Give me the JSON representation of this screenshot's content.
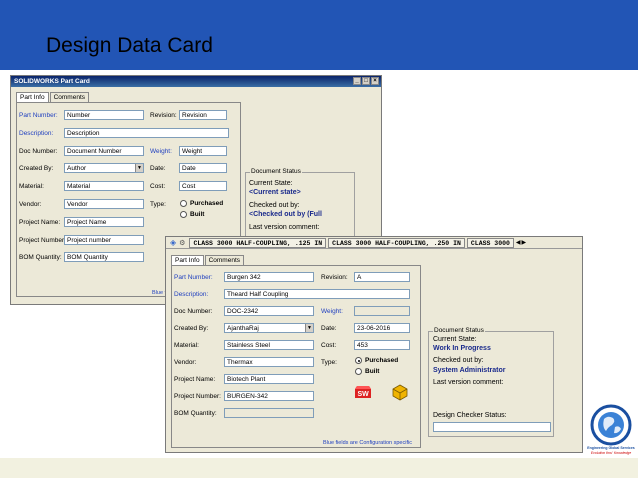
{
  "slide": {
    "title": "Design Data Card"
  },
  "back_window": {
    "title": "SOLIDWORKS Part Card",
    "tabs": [
      "Part Info",
      "Comments"
    ],
    "labels": {
      "part_number": "Part Number:",
      "description": "Description:",
      "doc_number": "Doc Number:",
      "created_by": "Created By:",
      "material": "Material:",
      "vendor": "Vendor:",
      "project_name": "Project Name:",
      "project_number": "Project Number:",
      "bom_quantity": "BOM Quantity:",
      "revision": "Revision:",
      "weight": "Weight:",
      "date": "Date:",
      "cost": "Cost:",
      "type": "Type:"
    },
    "values": {
      "part_number": "Number",
      "description": "Description",
      "doc_number": "Document Number",
      "created_by": "Author",
      "material": "Material",
      "vendor": "Vendor",
      "project_name": "Project Name",
      "project_number": "Project number",
      "bom_quantity": "BOM Quantity",
      "revision": "Revision",
      "weight": "Weight",
      "date": "Date",
      "cost": "Cost"
    },
    "type_options": [
      "Purchased",
      "Built"
    ],
    "status": {
      "group_title": "Document Status",
      "current_state_label": "Current State:",
      "current_state": "<Current state>",
      "checked_out_label": "Checked out by:",
      "checked_out": "<Checked out by (Full",
      "last_version_label": "Last version comment:"
    },
    "footnote": "Blue fie"
  },
  "front_window": {
    "config_tabs": [
      "CLASS 3000 HALF-COUPLING, .125 IN",
      "CLASS 3000 HALF-COUPLING, .250 IN",
      "CLASS 3000"
    ],
    "tabs": [
      "Part Info",
      "Comments"
    ],
    "labels": {
      "part_number": "Part Number:",
      "description": "Description:",
      "doc_number": "Doc Number:",
      "created_by": "Created By:",
      "material": "Material:",
      "vendor": "Vendor:",
      "project_name": "Project Name:",
      "project_number": "Project Number:",
      "bom_quantity": "BOM Quantity:",
      "revision": "Revision:",
      "weight": "Weight:",
      "date": "Date:",
      "cost": "Cost:",
      "type": "Type:"
    },
    "values": {
      "part_number": "Burgen 342",
      "description": "Theard Half Coupling",
      "doc_number": "DOC-2342",
      "created_by": "AjanthaRaj",
      "material": "Stainless Steel",
      "vendor": "Thermax",
      "project_name": "Biotech Plant",
      "project_number": "BURGEN-342",
      "bom_quantity": "",
      "revision": "A",
      "weight": "",
      "date": "23-06-2016",
      "cost": "453"
    },
    "type_options": [
      "Purchased",
      "Built"
    ],
    "type_selected": "Purchased",
    "status": {
      "group_title": "Document Status",
      "current_state_label": "Current State:",
      "current_state": "Work In Progress",
      "checked_out_label": "Checked out by:",
      "checked_out": "System Administrator",
      "last_version_label": "Last version comment:",
      "design_checker_label": "Design Checker Status:",
      "design_checker_value": ""
    },
    "footnote": "Blue fields are Configuration specific"
  },
  "logo": {
    "ring_text": "Engineering Global Services",
    "tagline": "Evolution thru' Knowledge"
  },
  "colors": {
    "header": "#2255b5",
    "footer": "#f2f1e0",
    "label_blue": "#1f3fbf",
    "state_blue": "#1a2a8c"
  }
}
